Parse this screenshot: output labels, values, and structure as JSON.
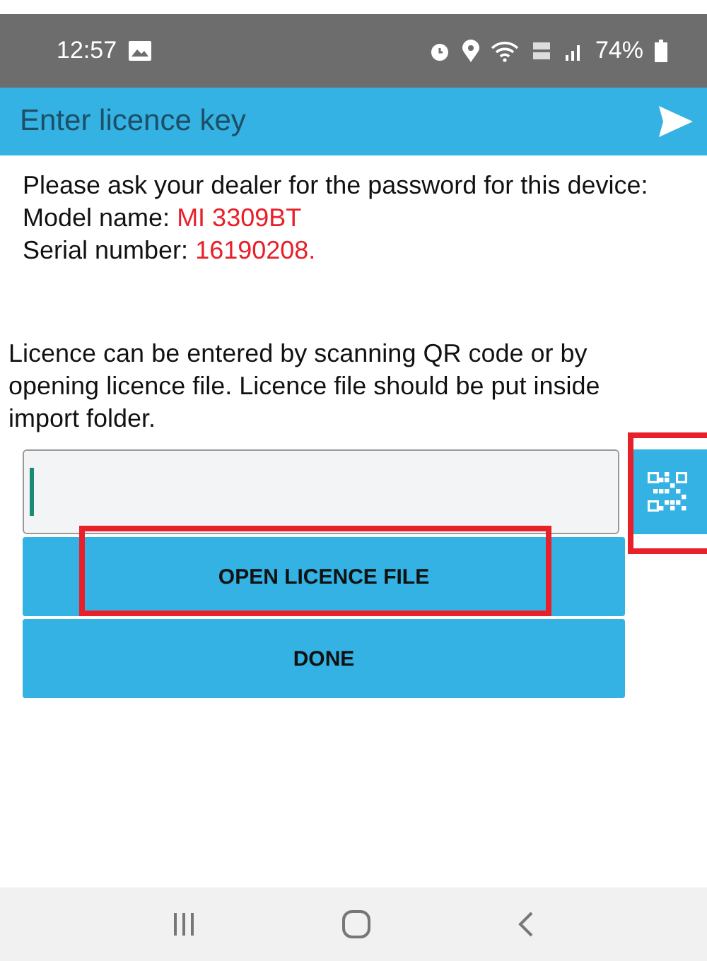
{
  "status_bar": {
    "time": "12:57",
    "battery": "74%"
  },
  "toolbar": {
    "title": "Enter licence key"
  },
  "info": {
    "intro": "Please ask your dealer for the password for this device:",
    "model_label": "Model name: ",
    "model": "MI 3309BT",
    "serial_label": "Serial number: ",
    "serial": "16190208."
  },
  "hint": "Licence can be entered by scanning QR code or by opening licence file. Licence file should be put inside import folder.",
  "key_field": {
    "focused": true
  },
  "qr_button": {
    "highlighted": true
  },
  "buttons": [
    {
      "label": "OPEN LICENCE FILE",
      "highlighted": true
    },
    {
      "label": "DONE",
      "highlighted": false
    }
  ]
}
